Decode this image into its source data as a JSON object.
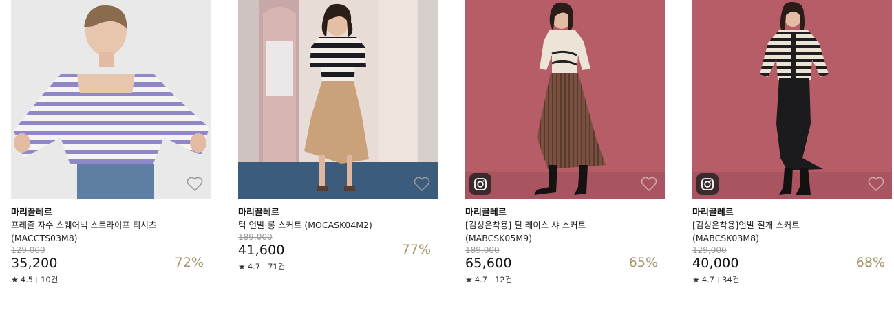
{
  "products": [
    {
      "brand": "마리끌레르",
      "name_line1": "프레즐 자수 스퀘어넥 스트라이프 티셔츠",
      "name_line2": "(MACCTS03M8)",
      "original_price": "129,000",
      "sale_price": "35,200",
      "discount": "72%",
      "rating": "4.5",
      "reviews": "10건",
      "has_instagram": false
    },
    {
      "brand": "마리끌레르",
      "name_line1": "턱 언발 롱 스커트 (MOCASK04M2)",
      "name_line2": "",
      "original_price": "189,000",
      "sale_price": "41,600",
      "discount": "77%",
      "rating": "4.7",
      "reviews": "71건",
      "has_instagram": false
    },
    {
      "brand": "마리끌레르",
      "name_line1": "[김성은착용] 펄 레이스 샤 스커트",
      "name_line2": "(MABCSK05M9)",
      "original_price": "189,000",
      "sale_price": "65,600",
      "discount": "65%",
      "rating": "4.7",
      "reviews": "12건",
      "has_instagram": true
    },
    {
      "brand": "마리끌레르",
      "name_line1": "[김성은착용]언발 절개 스커트",
      "name_line2": "(MABCSK03M8)",
      "original_price": "129,000",
      "sale_price": "40,000",
      "discount": "68%",
      "rating": "4.7",
      "reviews": "34건",
      "has_instagram": true
    }
  ],
  "icons": {
    "wishlist": "heart-outline-icon",
    "instagram": "instagram-icon",
    "rating": "star-icon"
  },
  "colors": {
    "discount": "#a6946b",
    "thumb_bg_pink": "#b8606a"
  }
}
